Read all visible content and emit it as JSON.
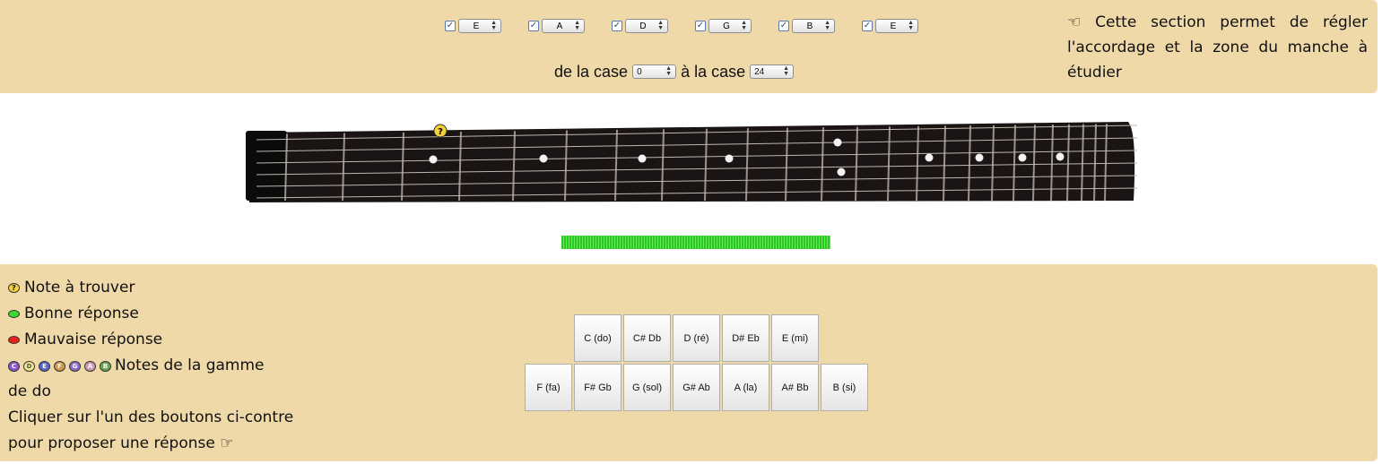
{
  "tuning": {
    "strings": [
      {
        "note": "E",
        "checked": true
      },
      {
        "note": "A",
        "checked": true
      },
      {
        "note": "D",
        "checked": true
      },
      {
        "note": "G",
        "checked": true
      },
      {
        "note": "B",
        "checked": true
      },
      {
        "note": "E",
        "checked": true
      }
    ],
    "from_label": "de la case",
    "from_value": "0",
    "to_label": "à la case",
    "to_value": "24",
    "help_icon": "pointing-left-hand-icon",
    "help_lines": [
      "Cette section permet de régler",
      "l'accordage et la zone du manche à",
      "étudier"
    ]
  },
  "fretboard": {
    "question_marker": "?",
    "progress_fraction": 1.0
  },
  "legend": {
    "find_note": "Note à trouver",
    "good": "Bonne réponse",
    "bad": "Mauvaise réponse",
    "scale_letters": [
      "C",
      "D",
      "E",
      "F",
      "G",
      "A",
      "B"
    ],
    "scale_line1": "Notes de la gamme",
    "scale_line2": "de do",
    "instr_line1": "Cliquer sur l'un des boutons ci-contre",
    "instr_line2": "pour proposer une réponse",
    "instr_icon": "pointing-right-hand-icon",
    "colors": {
      "good": "#3ed82e",
      "bad": "#e8231c",
      "question": "#f6d23a"
    }
  },
  "notes": {
    "row1": [
      "C (do)",
      "C# Db",
      "D (ré)",
      "D# Eb",
      "E (mi)"
    ],
    "row2": [
      "F (fa)",
      "F# Gb",
      "G (sol)",
      "G# Ab",
      "A (la)",
      "A# Bb",
      "B (si)"
    ]
  }
}
